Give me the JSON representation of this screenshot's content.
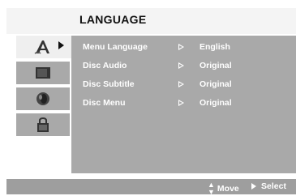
{
  "menu": {
    "title": "LANGUAGE"
  },
  "sidebar": {
    "tabs": [
      {
        "icon": "language-icon",
        "active": true
      },
      {
        "icon": "display-icon",
        "active": false
      },
      {
        "icon": "audio-icon",
        "active": false
      },
      {
        "icon": "lock-icon",
        "active": false
      }
    ]
  },
  "settings": [
    {
      "label": "Menu Language",
      "value": "English"
    },
    {
      "label": "Disc Audio",
      "value": "Original"
    },
    {
      "label": "Disc Subtitle",
      "value": "Original"
    },
    {
      "label": "Disc Menu",
      "value": "Original"
    }
  ],
  "footer": {
    "move_label": "Move",
    "select_label": "Select"
  },
  "colors": {
    "panel": "#a9a9a9",
    "active_tab": "#efefef",
    "text": "#ffffff"
  }
}
